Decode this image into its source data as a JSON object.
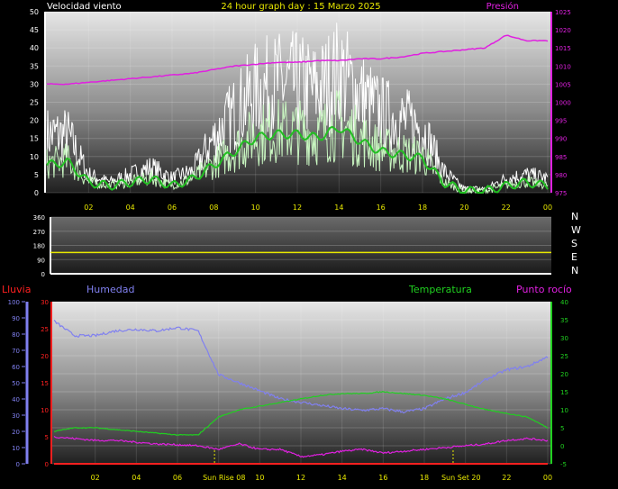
{
  "header": {
    "title": "24 hour graph day : 15 Marzo 2025",
    "wind_label": "Velocidad viento",
    "pressure_label": "Presión"
  },
  "bottom_labels": {
    "rain": "Lluvia",
    "humidity": "Humedad",
    "temperature": "Temperatura",
    "dewpoint": "Punto rocío"
  },
  "colors": {
    "background": "#000000",
    "wind_gust": "#ffffff",
    "wind_speed": "#c8f5c0",
    "wind_avg": "#22c022",
    "pressure": "#e020e0",
    "direction_line": "#e8e800",
    "rain": "#ff2020",
    "humidity": "#8080f0",
    "temperature": "#20d020",
    "dewpoint": "#e020e0",
    "sun_marker": "#e8e800"
  },
  "chart_data": [
    {
      "type": "line",
      "title": "24 hour graph day : 15 Marzo 2025",
      "xlabel": "",
      "x_tick_labels": [
        "02",
        "04",
        "06",
        "08",
        "10",
        "12",
        "14",
        "16",
        "18",
        "20",
        "22",
        "00"
      ],
      "y_left_label": "Velocidad viento",
      "y_left_ticks": [
        0,
        5,
        10,
        15,
        20,
        25,
        30,
        35,
        40,
        45,
        50
      ],
      "y_left_lim": [
        0,
        50
      ],
      "y_right_label": "Presión",
      "y_right_ticks": [
        975,
        980,
        985,
        990,
        995,
        1000,
        1005,
        1010,
        1015,
        1020,
        1025
      ],
      "y_right_lim": [
        975,
        1025
      ],
      "x": [
        0,
        1,
        2,
        3,
        4,
        5,
        6,
        7,
        8,
        9,
        10,
        11,
        12,
        13,
        14,
        15,
        16,
        17,
        18,
        19,
        20,
        21,
        22,
        23,
        24
      ],
      "series": [
        {
          "name": "Presión",
          "axis": "right",
          "values": [
            1005,
            1005,
            1005.5,
            1006,
            1006.5,
            1007,
            1007.5,
            1008,
            1009,
            1010,
            1010.5,
            1011,
            1011,
            1011.5,
            1011.5,
            1012,
            1012,
            1012.5,
            1013.5,
            1014,
            1014.5,
            1015,
            1018.5,
            1017,
            1017
          ]
        },
        {
          "name": "",
          "axis": "left",
          "values": [
            16,
            16,
            5,
            3,
            5,
            7,
            4,
            6,
            15,
            22,
            28,
            30,
            30,
            28,
            33,
            27,
            22,
            20,
            18,
            6,
            1,
            1,
            4,
            5,
            4
          ]
        },
        {
          "name": "",
          "axis": "left",
          "values": [
            8,
            9,
            3,
            2,
            3,
            4,
            2,
            4,
            8,
            12,
            16,
            17,
            17,
            16,
            19,
            15,
            12,
            11,
            10,
            3,
            0.5,
            0.5,
            2,
            3,
            2
          ]
        },
        {
          "name": "",
          "axis": "left",
          "values": [
            5,
            5,
            2,
            1,
            2,
            2,
            1,
            2,
            4,
            6,
            8,
            9,
            9,
            8,
            10,
            8,
            6,
            6,
            5,
            1.5,
            0.2,
            0.2,
            1,
            1.5,
            1
          ]
        }
      ]
    },
    {
      "type": "line",
      "x_tick_labels": [],
      "y_left_ticks": [
        0,
        90,
        180,
        270,
        360
      ],
      "y_left_lim": [
        0,
        360
      ],
      "y_right_tick_labels": [
        "N",
        "W",
        "S",
        "E",
        "N"
      ],
      "series": [
        {
          "name": "",
          "values": [
            135,
            135,
            135,
            135,
            135,
            135,
            135,
            135,
            135,
            135,
            135,
            135,
            135,
            135,
            135,
            135,
            135,
            135,
            135,
            135,
            135,
            135,
            135,
            135,
            135
          ]
        }
      ]
    },
    {
      "type": "line",
      "x_tick_labels": [
        "02",
        "04",
        "06",
        "08",
        "10",
        "12",
        "14",
        "16",
        "18",
        "20",
        "22",
        "00"
      ],
      "y_humidity_label": "Humedad",
      "y_humidity_ticks": [
        0,
        10,
        20,
        30,
        40,
        50,
        60,
        70,
        80,
        90,
        100
      ],
      "y_humidity_lim": [
        0,
        100
      ],
      "y_rain_label": "Lluvia",
      "y_rain_ticks": [
        0,
        5,
        10,
        15,
        20,
        25,
        30
      ],
      "y_rain_lim": [
        0,
        30
      ],
      "y_temp_label": "Temperatura",
      "y_temp_ticks": [
        -5,
        0,
        5,
        10,
        15,
        20,
        25,
        30,
        35,
        40
      ],
      "y_temp_lim": [
        -5,
        40
      ],
      "annotations": [
        "Sun Rise 08",
        "Sun Set 20"
      ],
      "sunrise_hour": 7.8,
      "sunset_hour": 19.4,
      "x": [
        0,
        1,
        2,
        3,
        4,
        5,
        6,
        7,
        8,
        9,
        10,
        11,
        12,
        13,
        14,
        15,
        16,
        17,
        18,
        19,
        20,
        21,
        22,
        23,
        24
      ],
      "series": [
        {
          "name": "Humedad",
          "axis": "humidity",
          "values": [
            88,
            79,
            79,
            82,
            83,
            82,
            84,
            82,
            55,
            50,
            45,
            40,
            38,
            36,
            34,
            33,
            34,
            32,
            34,
            40,
            44,
            52,
            58,
            60,
            66
          ]
        },
        {
          "name": "Temperatura",
          "axis": "temp",
          "values": [
            4,
            5,
            5,
            4.5,
            4,
            3.5,
            3,
            3,
            8,
            10,
            11,
            12,
            13,
            14,
            14.5,
            14.5,
            15,
            14.5,
            14,
            13,
            11.5,
            10,
            9,
            8,
            5
          ]
        },
        {
          "name": "Punto rocío",
          "axis": "temp",
          "values": [
            2.5,
            2,
            1.5,
            1.5,
            1,
            0.5,
            0.3,
            0,
            -1,
            0.5,
            -1,
            -1,
            -3,
            -2.5,
            -1.5,
            -1,
            -2,
            -1.5,
            -1,
            -0.5,
            0,
            0.5,
            1.5,
            2,
            1.5
          ]
        },
        {
          "name": "Lluvia",
          "axis": "rain",
          "values": [
            0,
            0,
            0,
            0,
            0,
            0,
            0,
            0,
            0,
            0,
            0,
            0,
            0,
            0,
            0,
            0,
            0,
            0,
            0,
            0,
            0,
            0,
            0,
            0,
            0
          ]
        }
      ]
    }
  ]
}
